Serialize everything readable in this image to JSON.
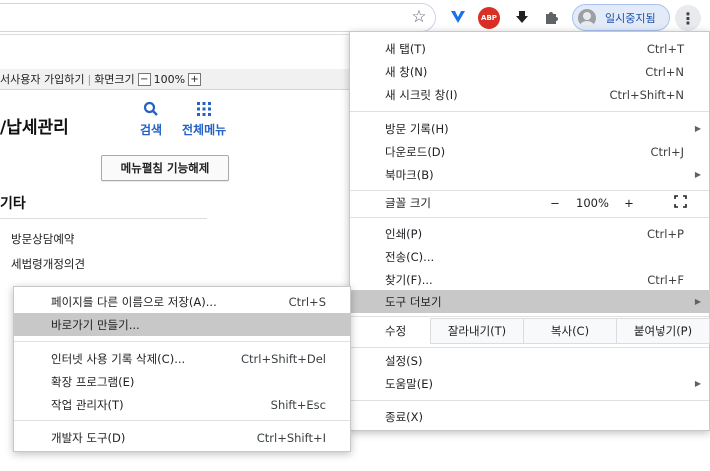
{
  "toolbar": {
    "profile_name": "일시중지됨",
    "abp_label": "ABP",
    "star_icon": "☆",
    "kebab_icon": "⋮"
  },
  "page": {
    "strip_link": "서사용자 가입하기",
    "strip_screen_size": "화면크기",
    "zoom_minus": "−",
    "zoom_value": "100%",
    "zoom_plus": "+",
    "site_title": "/납세관리",
    "nav_search": "검색",
    "nav_allmenu": "전체메뉴",
    "menu_toggle": "메뉴펼침 기능해제",
    "section_head": "기타",
    "links": [
      "방문상담예약",
      "세법령개정의견"
    ]
  },
  "chrome_menu": {
    "new_tab": {
      "label": "새 탭(T)",
      "shortcut": "Ctrl+T"
    },
    "new_window": {
      "label": "새 창(N)",
      "shortcut": "Ctrl+N"
    },
    "incognito": {
      "label": "새 시크릿 창(I)",
      "shortcut": "Ctrl+Shift+N"
    },
    "history": {
      "label": "방문 기록(H)"
    },
    "downloads": {
      "label": "다운로드(D)",
      "shortcut": "Ctrl+J"
    },
    "bookmarks": {
      "label": "북마크(B)"
    },
    "zoom": {
      "label": "글꼴 크기",
      "minus": "−",
      "value": "100%",
      "plus": "+"
    },
    "print": {
      "label": "인쇄(P)",
      "shortcut": "Ctrl+P"
    },
    "cast": {
      "label": "전송(C)..."
    },
    "find": {
      "label": "찾기(F)...",
      "shortcut": "Ctrl+F"
    },
    "more_tools": {
      "label": "도구 더보기"
    },
    "edit": {
      "label": "수정",
      "cut": "잘라내기(T)",
      "copy": "복사(C)",
      "paste": "붙여넣기(P)"
    },
    "settings": {
      "label": "설정(S)"
    },
    "help": {
      "label": "도움말(E)"
    },
    "exit": {
      "label": "종료(X)"
    }
  },
  "sub_menu": {
    "save_page": {
      "label": "페이지를 다른 이름으로 저장(A)...",
      "shortcut": "Ctrl+S"
    },
    "create_shortcut": {
      "label": "바로가기 만들기..."
    },
    "clear_data": {
      "label": "인터넷 사용 기록 삭제(C)...",
      "shortcut": "Ctrl+Shift+Del"
    },
    "extensions": {
      "label": "확장 프로그램(E)"
    },
    "task_manager": {
      "label": "작업 관리자(T)",
      "shortcut": "Shift+Esc"
    },
    "dev_tools": {
      "label": "개발자 도구(D)",
      "shortcut": "Ctrl+Shift+I"
    }
  },
  "colors": {
    "highlight": "#c8c8c8",
    "link_blue": "#2462c5",
    "abp_red": "#d93025"
  }
}
